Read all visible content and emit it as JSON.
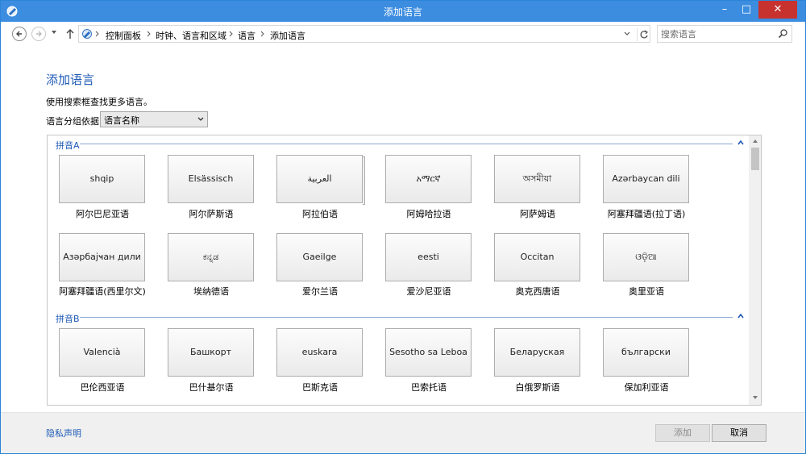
{
  "window": {
    "title": "添加语言",
    "min": "–",
    "max": "□",
    "close": "✕"
  },
  "nav": {
    "breadcrumbs": [
      "控制面板",
      "时钟、语言和区域",
      "语言",
      "添加语言"
    ],
    "search_placeholder": "搜索语言"
  },
  "main": {
    "title": "添加语言",
    "intro": "使用搜索框查找更多语言。",
    "group_label": "语言分组依据:",
    "group_value": "语言名称"
  },
  "sections": [
    {
      "header": "拼音A",
      "tiles": [
        {
          "native": "shqip",
          "name": "阿尔巴尼亚语"
        },
        {
          "native": "Elsässisch",
          "name": "阿尔萨斯语"
        },
        {
          "native": "العربية",
          "name": "阿拉伯语"
        },
        {
          "native": "አማርኛ",
          "name": "阿姆哈拉语"
        },
        {
          "native": "অসমীয়া",
          "name": "阿萨姆语"
        },
        {
          "native": "Azərbaycan dili",
          "name": "阿塞拜疆语(拉丁语)"
        },
        {
          "native": "Азәрбајҹан дили",
          "name": "阿塞拜疆语(西里尔文)"
        },
        {
          "native": "ಕನ್ನಡ",
          "name": "埃纳德语"
        },
        {
          "native": "Gaeilge",
          "name": "爱尔兰语"
        },
        {
          "native": "eesti",
          "name": "爱沙尼亚语"
        },
        {
          "native": "Occitan",
          "name": "奥克西唐语"
        },
        {
          "native": "ଓଡ଼ିଆ",
          "name": "奥里亚语"
        }
      ]
    },
    {
      "header": "拼音B",
      "tiles": [
        {
          "native": "Valencià",
          "name": "巴伦西亚语"
        },
        {
          "native": "Башкорт",
          "name": "巴什基尔语"
        },
        {
          "native": "euskara",
          "name": "巴斯克语"
        },
        {
          "native": "Sesotho sa Leboa",
          "name": "巴索托语"
        },
        {
          "native": "Беларуская",
          "name": "白俄罗斯语"
        },
        {
          "native": "български",
          "name": "保加利亚语"
        }
      ]
    }
  ],
  "footer": {
    "privacy": "隐私声明",
    "add": "添加",
    "cancel": "取消"
  }
}
